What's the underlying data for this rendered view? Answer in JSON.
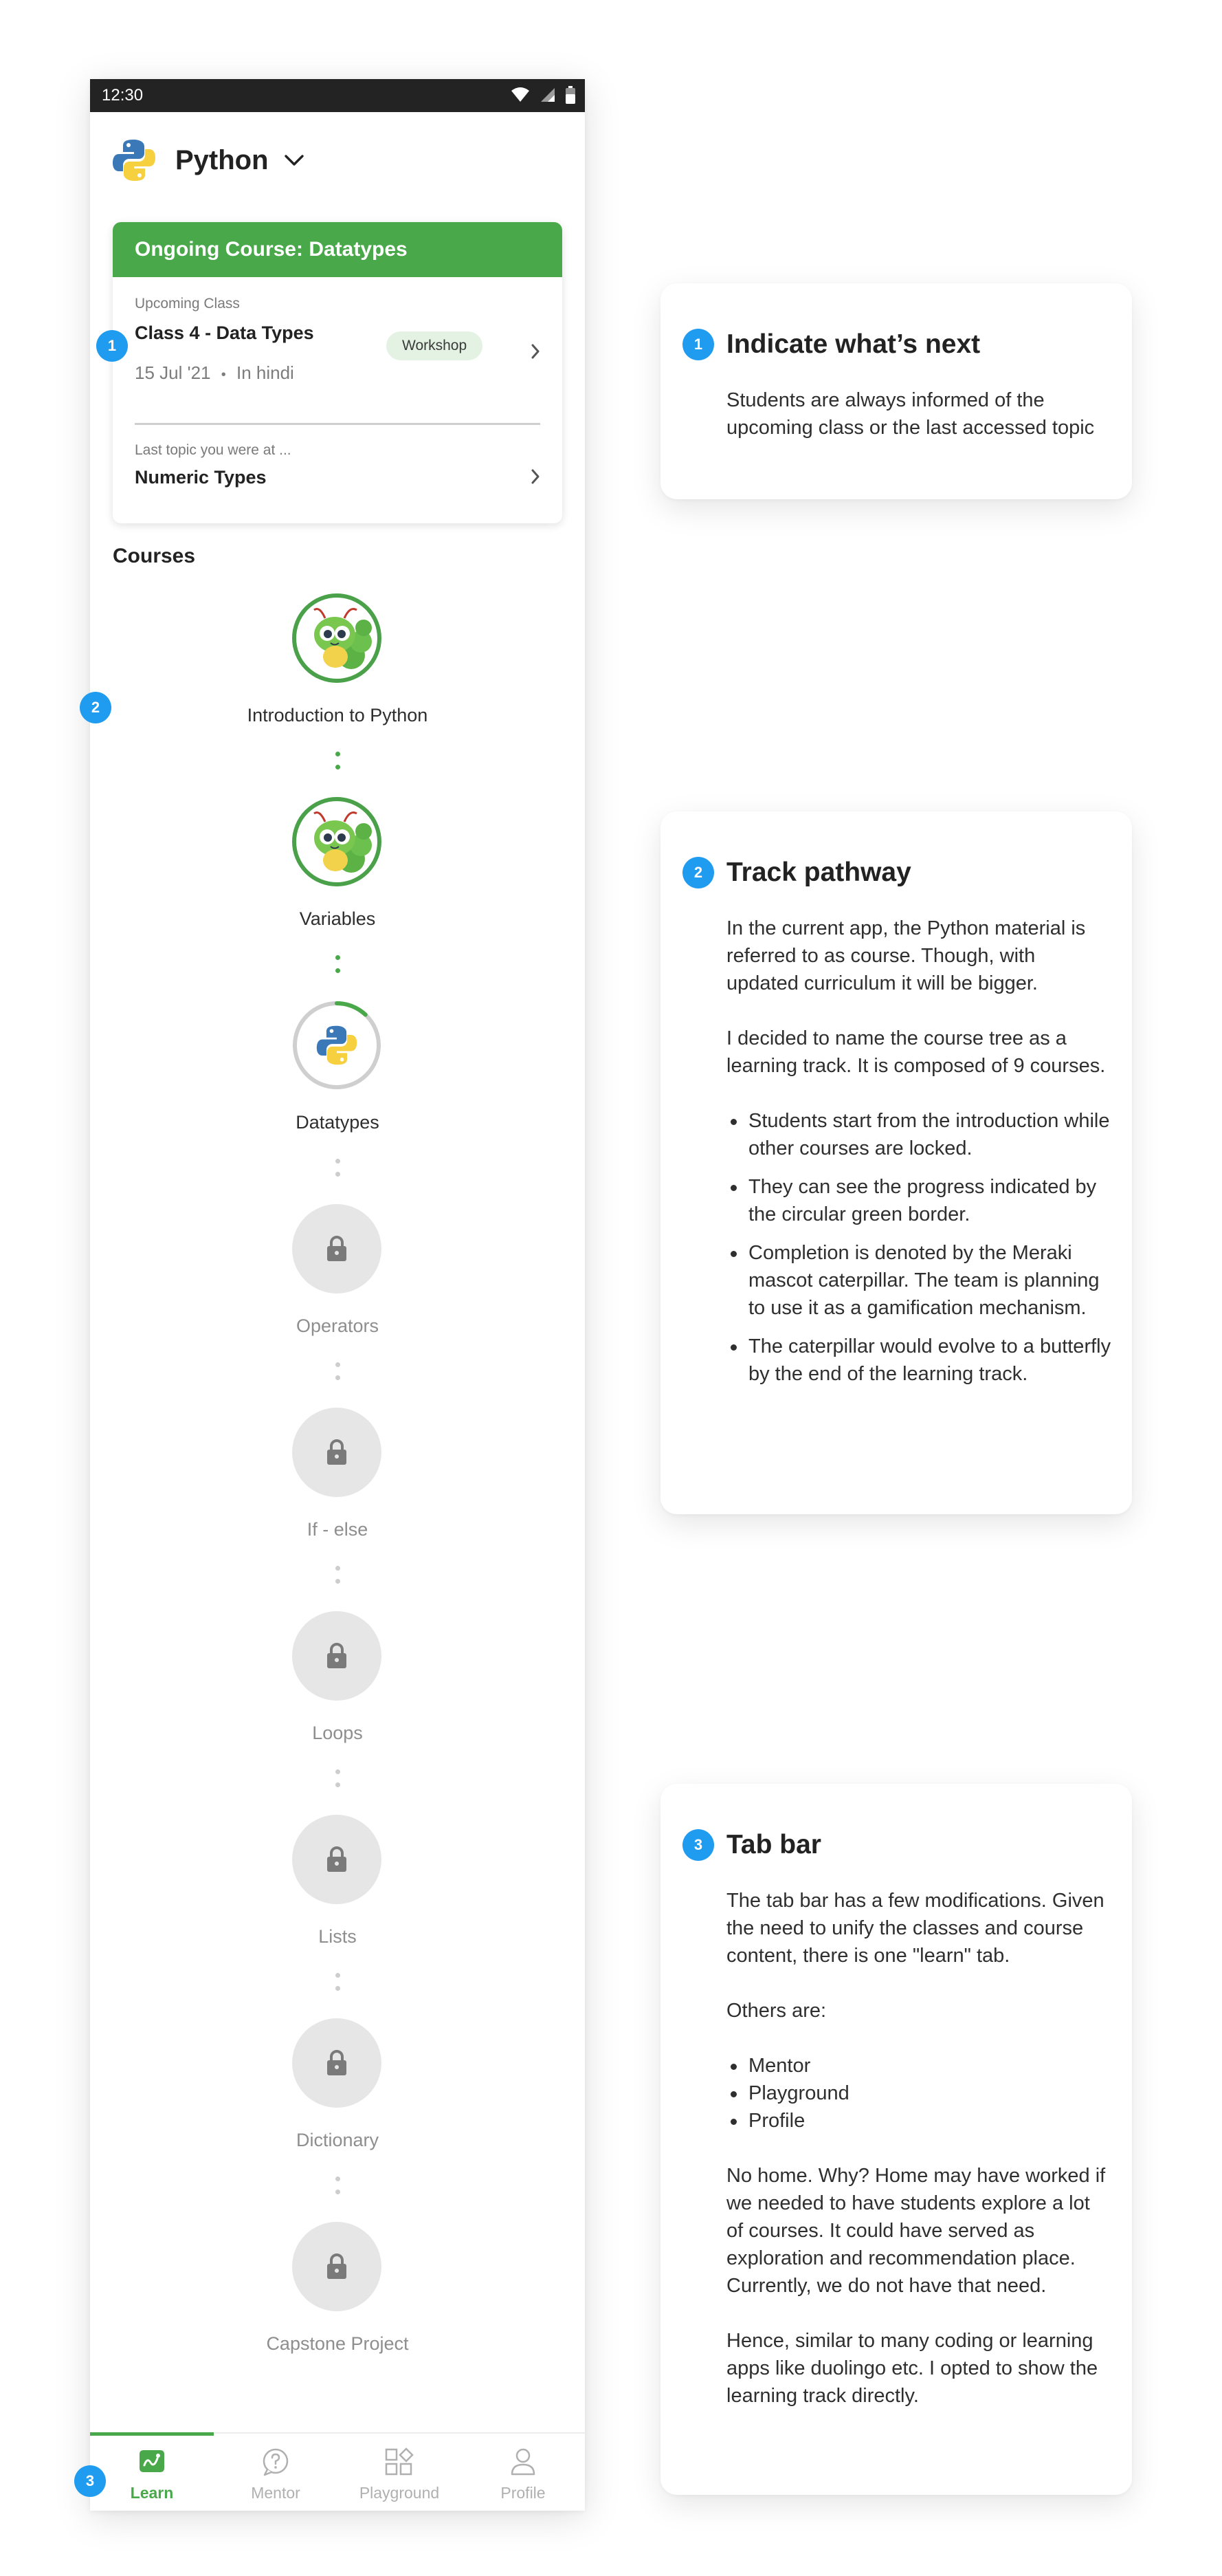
{
  "status_bar": {
    "time": "12:30"
  },
  "header": {
    "title": "Python"
  },
  "ongoing": {
    "title": "Ongoing Course: Datatypes",
    "upcoming_label": "Upcoming Class",
    "class_title": "Class 4 - Data Types",
    "tag": "Workshop",
    "date": "15 Jul '21",
    "separator": "•",
    "language": "In hindi",
    "last_topic_label": "Last topic you were at ...",
    "last_topic": "Numeric Types"
  },
  "courses": {
    "heading": "Courses",
    "items": [
      {
        "label": "Introduction to Python",
        "state": "completed"
      },
      {
        "label": "Variables",
        "state": "completed"
      },
      {
        "label": "Datatypes",
        "state": "in-progress",
        "progress": 0.12
      },
      {
        "label": "Operators",
        "state": "locked"
      },
      {
        "label": "If - else",
        "state": "locked"
      },
      {
        "label": "Loops",
        "state": "locked"
      },
      {
        "label": "Lists",
        "state": "locked"
      },
      {
        "label": "Dictionary",
        "state": "locked"
      },
      {
        "label": "Capstone Project",
        "state": "locked"
      }
    ]
  },
  "tabs": [
    {
      "label": "Learn",
      "active": true
    },
    {
      "label": "Mentor",
      "active": false
    },
    {
      "label": "Playground",
      "active": false
    },
    {
      "label": "Profile",
      "active": false
    }
  ],
  "markers": [
    "1",
    "2",
    "3"
  ],
  "notes": [
    {
      "number": "1",
      "title": "Indicate what’s next",
      "p1": "Students are always informed of the upcoming class or the last accessed topic"
    },
    {
      "number": "2",
      "title": "Track pathway",
      "p1": "In the current app, the Python material is referred to as course. Though, with updated curriculum it will be bigger.",
      "p2": "I decided to name the course tree as a learning track. It is composed of 9 courses.",
      "bullets": [
        "Students start from the introduction while other courses are locked.",
        "They can see the progress indicated by the circular green border.",
        "Completion is denoted by the Meraki mascot caterpillar. The team is planning to use it as a gamification mechanism.",
        "The caterpillar would evolve to a butterfly by the end of the learning track."
      ]
    },
    {
      "number": "3",
      "title": "Tab bar",
      "p1": "The tab bar has a few modifications. Given the need to unify the classes and course content, there is one \"learn\" tab.",
      "p2": "Others are:",
      "bullets": [
        "Mentor",
        "Playground",
        "Profile"
      ],
      "p3": "No home. Why? Home may have worked if we needed to have students explore a lot of courses. It could have served as exploration and recommendation place. Currently, we do not have that need.",
      "p4": "Hence, similar to many coding or learning apps like duolingo etc. I opted to show the learning track directly."
    }
  ],
  "colors": {
    "accent_green": "#49a84a",
    "marker_blue": "#1f9bef",
    "status_bar": "#232323",
    "locked_grey": "#e6e6e6"
  },
  "icons": [
    "wifi-icon",
    "signal-icon",
    "battery-icon",
    "python-logo-icon",
    "chevron-down-icon",
    "chevron-right-icon",
    "caterpillar-mascot-icon",
    "lock-icon",
    "learn-tab-icon",
    "mentor-tab-icon",
    "playground-tab-icon",
    "profile-tab-icon"
  ]
}
